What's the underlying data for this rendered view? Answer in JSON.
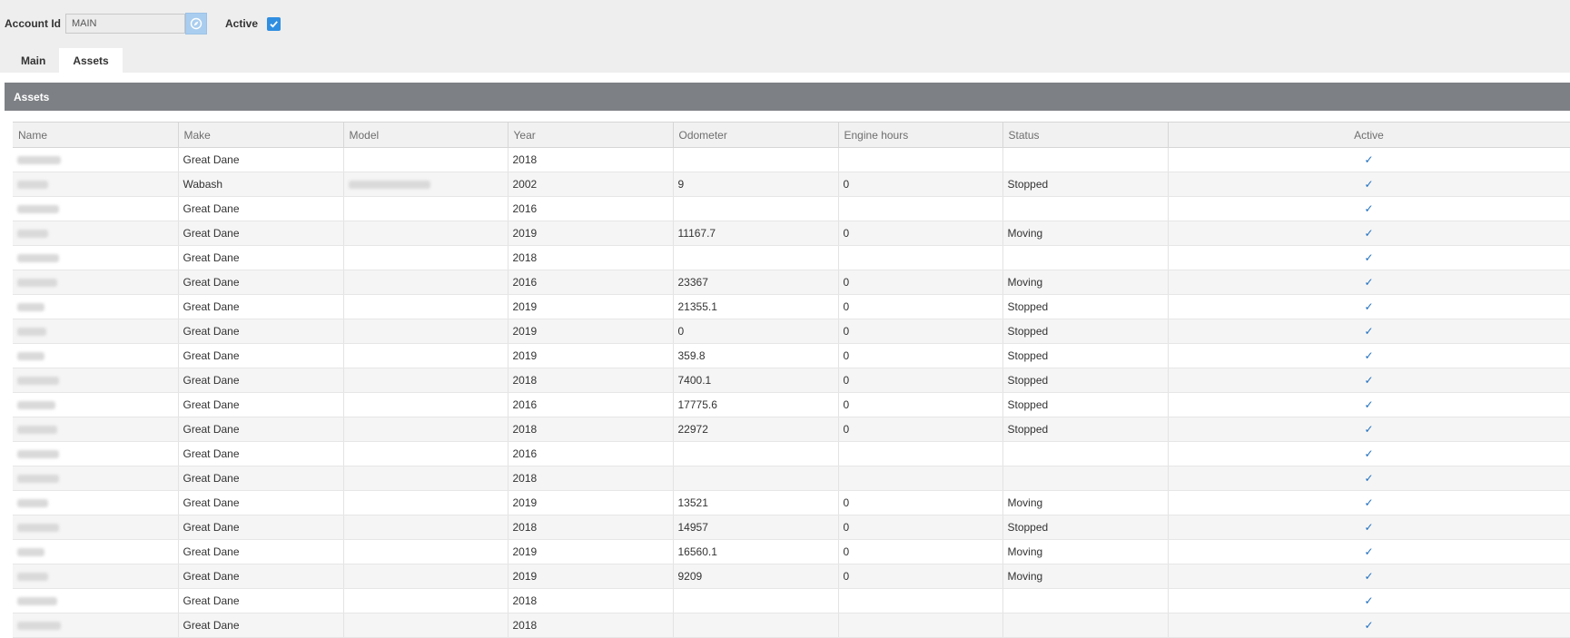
{
  "header": {
    "account_id_label": "Account Id",
    "account_id_value": "MAIN",
    "active_label": "Active",
    "active_checked": true
  },
  "tabs": [
    {
      "label": "Main",
      "selected": false
    },
    {
      "label": "Assets",
      "selected": true
    }
  ],
  "panel": {
    "title": "Assets"
  },
  "table": {
    "columns": [
      "Name",
      "Make",
      "Model",
      "Year",
      "Odometer",
      "Engine hours",
      "Status",
      "Active"
    ],
    "rows": [
      {
        "make": "Great Dane",
        "year": "2018",
        "odometer": "",
        "engine_hours": "",
        "status": "",
        "active": true
      },
      {
        "make": "Wabash",
        "year": "2002",
        "odometer": "9",
        "engine_hours": "0",
        "status": "Stopped",
        "active": true
      },
      {
        "make": "Great Dane",
        "year": "2016",
        "odometer": "",
        "engine_hours": "",
        "status": "",
        "active": true
      },
      {
        "make": "Great Dane",
        "year": "2019",
        "odometer": "11167.7",
        "engine_hours": "0",
        "status": "Moving",
        "active": true
      },
      {
        "make": "Great Dane",
        "year": "2018",
        "odometer": "",
        "engine_hours": "",
        "status": "",
        "active": true
      },
      {
        "make": "Great Dane",
        "year": "2016",
        "odometer": "23367",
        "engine_hours": "0",
        "status": "Moving",
        "active": true
      },
      {
        "make": "Great Dane",
        "year": "2019",
        "odometer": "21355.1",
        "engine_hours": "0",
        "status": "Stopped",
        "active": true
      },
      {
        "make": "Great Dane",
        "year": "2019",
        "odometer": "0",
        "engine_hours": "0",
        "status": "Stopped",
        "active": true
      },
      {
        "make": "Great Dane",
        "year": "2019",
        "odometer": "359.8",
        "engine_hours": "0",
        "status": "Stopped",
        "active": true
      },
      {
        "make": "Great Dane",
        "year": "2018",
        "odometer": "7400.1",
        "engine_hours": "0",
        "status": "Stopped",
        "active": true
      },
      {
        "make": "Great Dane",
        "year": "2016",
        "odometer": "17775.6",
        "engine_hours": "0",
        "status": "Stopped",
        "active": true
      },
      {
        "make": "Great Dane",
        "year": "2018",
        "odometer": "22972",
        "engine_hours": "0",
        "status": "Stopped",
        "active": true
      },
      {
        "make": "Great Dane",
        "year": "2016",
        "odometer": "",
        "engine_hours": "",
        "status": "",
        "active": true
      },
      {
        "make": "Great Dane",
        "year": "2018",
        "odometer": "",
        "engine_hours": "",
        "status": "",
        "active": true
      },
      {
        "make": "Great Dane",
        "year": "2019",
        "odometer": "13521",
        "engine_hours": "0",
        "status": "Moving",
        "active": true
      },
      {
        "make": "Great Dane",
        "year": "2018",
        "odometer": "14957",
        "engine_hours": "0",
        "status": "Stopped",
        "active": true
      },
      {
        "make": "Great Dane",
        "year": "2019",
        "odometer": "16560.1",
        "engine_hours": "0",
        "status": "Moving",
        "active": true
      },
      {
        "make": "Great Dane",
        "year": "2019",
        "odometer": "9209",
        "engine_hours": "0",
        "status": "Moving",
        "active": true
      },
      {
        "make": "Great Dane",
        "year": "2018",
        "odometer": "",
        "engine_hours": "",
        "status": "",
        "active": true
      },
      {
        "make": "Great Dane",
        "year": "2018",
        "odometer": "",
        "engine_hours": "",
        "status": "",
        "active": true
      }
    ]
  }
}
